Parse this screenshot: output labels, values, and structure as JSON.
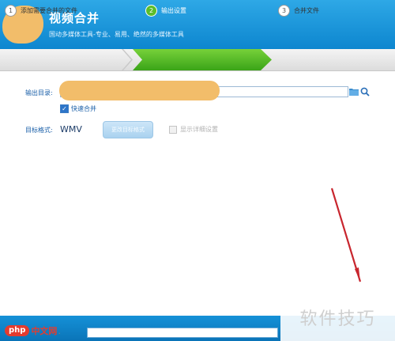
{
  "header": {
    "title": "视频合并",
    "subtitle": "国动多媒体工具-专业、易用、绝然的多媒体工具"
  },
  "steps": [
    {
      "num": "1",
      "label": "添加需要合并的文件"
    },
    {
      "num": "2",
      "label": "输出设置"
    },
    {
      "num": "3",
      "label": "合并文件"
    }
  ],
  "output": {
    "dir_label": "输出目录:",
    "dir_value": "",
    "fast_merge_label": "快速合并",
    "fast_merge_checked": true
  },
  "format": {
    "label": "目标格式:",
    "value": "WMV",
    "change_button": "更改目标格式",
    "advanced_label": "显示详细设置"
  },
  "progress": {
    "value": 0
  },
  "watermark": {
    "text": "软件技巧"
  },
  "php_logo": {
    "badge": "php",
    "cn": "中文网",
    "suffix": "."
  },
  "colors": {
    "header": "#0d86cf",
    "active_step": "#3aa418",
    "blur": "#f2bd6a"
  }
}
